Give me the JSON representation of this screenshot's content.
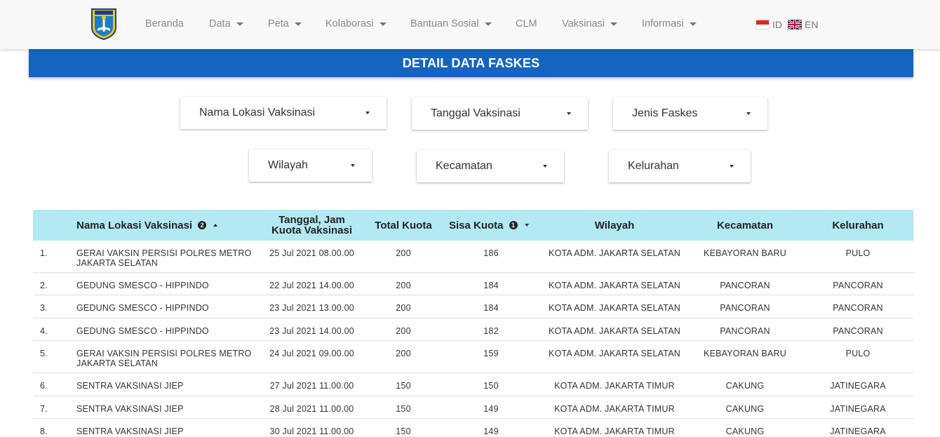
{
  "nav": {
    "items": [
      {
        "label": "Beranda",
        "dropdown": false
      },
      {
        "label": "Data",
        "dropdown": true
      },
      {
        "label": "Peta",
        "dropdown": true
      },
      {
        "label": "Kolaborasi",
        "dropdown": true
      },
      {
        "label": "Bantuan Sosial",
        "dropdown": true
      },
      {
        "label": "CLM",
        "dropdown": false
      },
      {
        "label": "Vaksinasi",
        "dropdown": true
      },
      {
        "label": "Informasi",
        "dropdown": true
      }
    ],
    "lang_id": "ID",
    "lang_en": "EN"
  },
  "page": {
    "title": "DETAIL DATA FASKES"
  },
  "filters": {
    "nama_lokasi": "Nama Lokasi Vaksinasi",
    "tanggal": "Tanggal Vaksinasi",
    "jenis_faskes": "Jenis Faskes",
    "wilayah": "Wilayah",
    "kecamatan": "Kecamatan",
    "kelurahan": "Kelurahan"
  },
  "table": {
    "headers": {
      "nama": "Nama Lokasi Vaksinasi",
      "nama_badge": "2",
      "tanggal_1": "Tanggal, Jam",
      "tanggal_2": "Kuota Vaksinasi",
      "total": "Total Kuota",
      "sisa": "Sisa Kuota",
      "sisa_badge": "1",
      "wilayah": "Wilayah",
      "kecamatan": "Kecamatan",
      "kelurahan": "Kelurahan"
    },
    "rows": [
      {
        "no": "1.",
        "nama_1": "GERAI VAKSIN PERSISI POLRES METRO",
        "nama_2": "JAKARTA SELATAN",
        "tanggal": "25 Jul 2021 08.00.00",
        "total": "200",
        "sisa": "186",
        "wilayah": "KOTA ADM. JAKARTA SELATAN",
        "kecamatan": "KEBAYORAN BARU",
        "kelurahan": "PULO"
      },
      {
        "no": "2.",
        "nama_1": "GEDUNG SMESCO - HIPPINDO",
        "nama_2": "",
        "tanggal": "22 Jul 2021 14.00.00",
        "total": "200",
        "sisa": "184",
        "wilayah": "KOTA ADM. JAKARTA SELATAN",
        "kecamatan": "PANCORAN",
        "kelurahan": "PANCORAN"
      },
      {
        "no": "3.",
        "nama_1": "GEDUNG SMESCO - HIPPINDO",
        "nama_2": "",
        "tanggal": "23 Jul 2021 13.00.00",
        "total": "200",
        "sisa": "184",
        "wilayah": "KOTA ADM. JAKARTA SELATAN",
        "kecamatan": "PANCORAN",
        "kelurahan": "PANCORAN"
      },
      {
        "no": "4.",
        "nama_1": "GEDUNG SMESCO - HIPPINDO",
        "nama_2": "",
        "tanggal": "23 Jul 2021 14.00.00",
        "total": "200",
        "sisa": "182",
        "wilayah": "KOTA ADM. JAKARTA SELATAN",
        "kecamatan": "PANCORAN",
        "kelurahan": "PANCORAN"
      },
      {
        "no": "5.",
        "nama_1": "GERAI VAKSIN PERSISI POLRES METRO",
        "nama_2": "JAKARTA SELATAN",
        "tanggal": "24 Jul 2021 09.00.00",
        "total": "200",
        "sisa": "159",
        "wilayah": "KOTA ADM. JAKARTA SELATAN",
        "kecamatan": "KEBAYORAN BARU",
        "kelurahan": "PULO"
      },
      {
        "no": "6.",
        "nama_1": "SENTRA VAKSINASI JIEP",
        "nama_2": "",
        "tanggal": "27 Jul 2021 11.00.00",
        "total": "150",
        "sisa": "150",
        "wilayah": "KOTA ADM. JAKARTA TIMUR",
        "kecamatan": "CAKUNG",
        "kelurahan": "JATINEGARA"
      },
      {
        "no": "7.",
        "nama_1": "SENTRA VAKSINASI JIEP",
        "nama_2": "",
        "tanggal": "28 Jul 2021 11.00.00",
        "total": "150",
        "sisa": "149",
        "wilayah": "KOTA ADM. JAKARTA TIMUR",
        "kecamatan": "CAKUNG",
        "kelurahan": "JATINEGARA"
      },
      {
        "no": "8.",
        "nama_1": "SENTRA VAKSINASI JIEP",
        "nama_2": "",
        "tanggal": "30 Jul 2021 11.00.00",
        "total": "150",
        "sisa": "149",
        "wilayah": "KOTA ADM. JAKARTA TIMUR",
        "kecamatan": "CAKUNG",
        "kelurahan": "JATINEGARA"
      }
    ]
  },
  "colors": {
    "title_bar": "#1565c0",
    "table_header": "#b3e9f3"
  }
}
